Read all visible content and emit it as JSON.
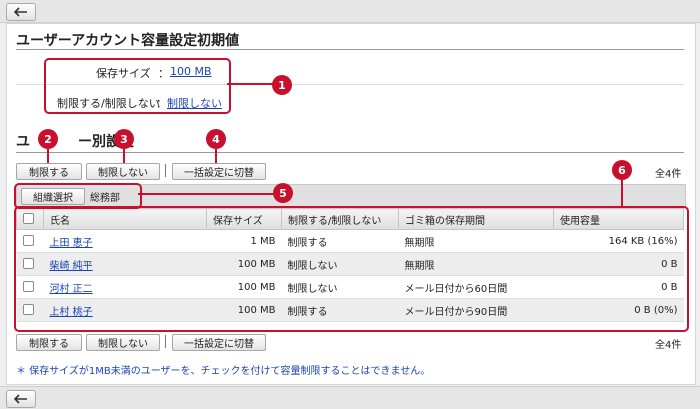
{
  "nav": {
    "back_label": "←"
  },
  "section1": {
    "title": "ユーザーアカウント容量設定初期値",
    "storage_label": "保存サイズ",
    "storage_value": "100 MB",
    "restrict_label": "制限する/制限しない",
    "restrict_value": "制限しない",
    "colon": "："
  },
  "section2": {
    "title_before": "ユ",
    "title_after": "ー別設定",
    "btn_restrict": "制限する",
    "btn_unrestrict": "制限しない",
    "btn_bulk": "一括設定に切替",
    "count": "全4件",
    "org_select": "組織選択",
    "org_name": "総務部"
  },
  "table": {
    "headers": [
      "氏名",
      "保存サイズ",
      "制限する/制限しない",
      "ゴミ箱の保存期間",
      "使用容量"
    ],
    "rows": [
      {
        "name": "上田 恵子",
        "size": "1 MB",
        "restrict": "制限する",
        "trash": "無期限",
        "usage": "164 KB (16%)"
      },
      {
        "name": "柴崎 純平",
        "size": "100 MB",
        "restrict": "制限しない",
        "trash": "無期限",
        "usage": "0 B"
      },
      {
        "name": "河村 正二",
        "size": "100 MB",
        "restrict": "制限しない",
        "trash": "メール日付から60日間",
        "usage": "0 B"
      },
      {
        "name": "上村 桃子",
        "size": "100 MB",
        "restrict": "制限する",
        "trash": "メール日付から90日間",
        "usage": "0 B (0%)"
      }
    ]
  },
  "note": "＊ 保存サイズが1MB未満のユーザーを、チェックを付けて容量制限することはできません。",
  "callouts": [
    "1",
    "2",
    "3",
    "4",
    "5",
    "6"
  ],
  "colors": {
    "accent": "#c8102e",
    "link": "#1a44b8"
  },
  "icons": {
    "back": "arrow-left-icon"
  }
}
